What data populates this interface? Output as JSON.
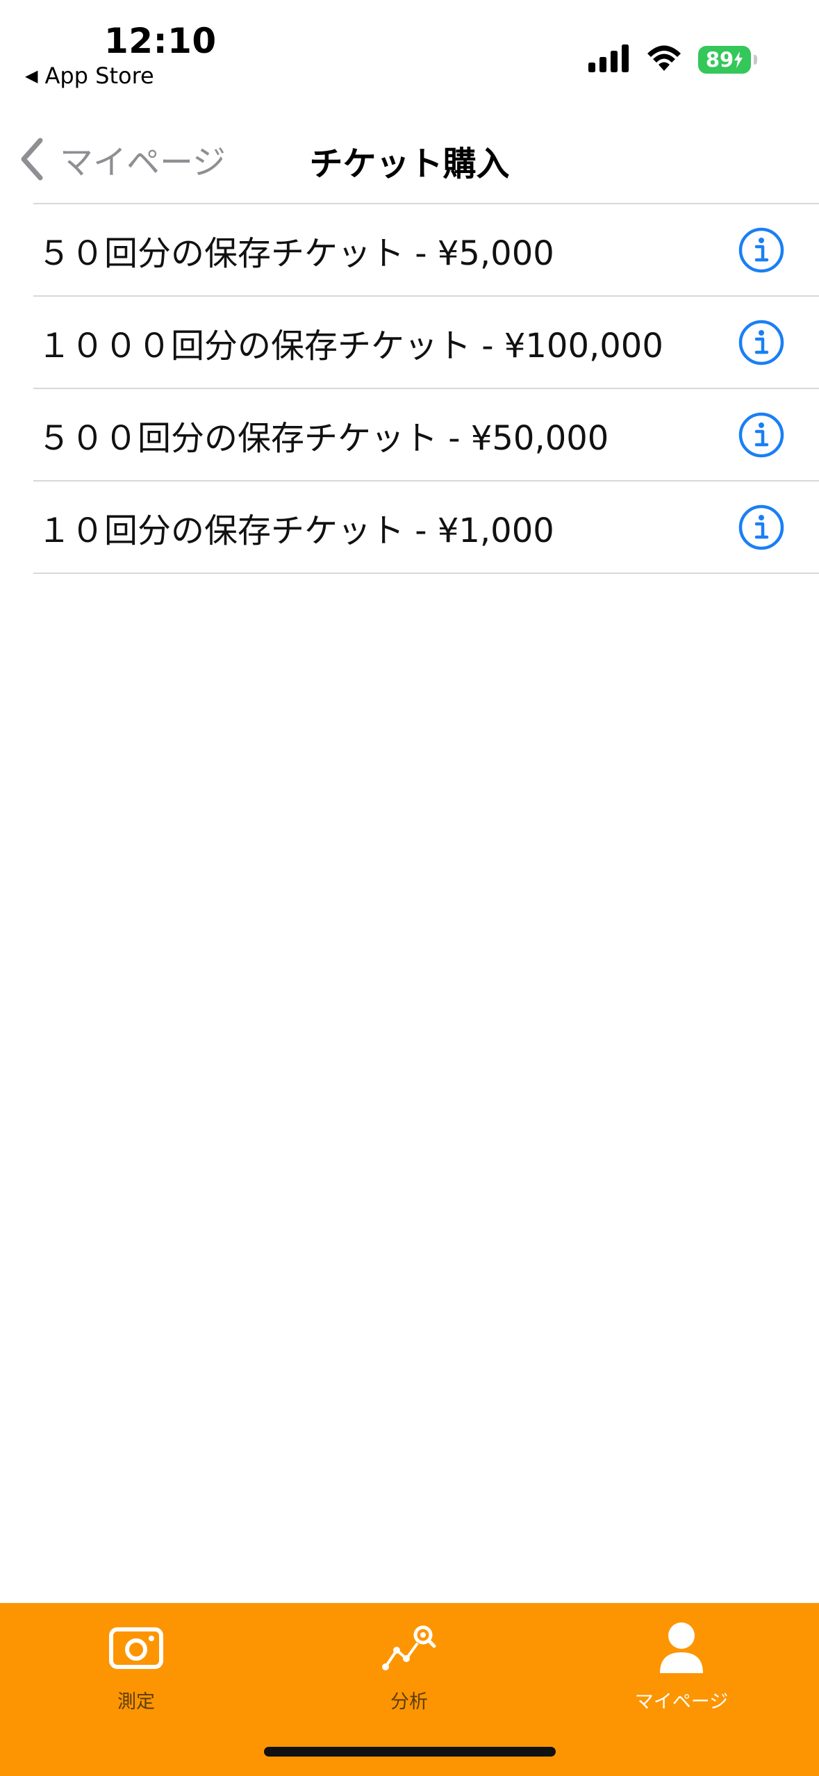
{
  "status_bar": {
    "time": "12:10",
    "back_app": "App Store",
    "battery": "89"
  },
  "nav": {
    "back_label": "マイページ",
    "title": "チケット購入"
  },
  "tickets": [
    {
      "label": "５０回分の保存チケット - ¥5,000"
    },
    {
      "label": "１０００回分の保存チケット - ¥100,000"
    },
    {
      "label": "５００回分の保存チケット - ¥50,000"
    },
    {
      "label": "１０回分の保存チケット - ¥1,000"
    }
  ],
  "tab_bar": {
    "items": [
      {
        "label": "測定",
        "icon": "camera-icon",
        "active": false
      },
      {
        "label": "分析",
        "icon": "analysis-icon",
        "active": false
      },
      {
        "label": "マイページ",
        "icon": "person-icon",
        "active": true
      }
    ]
  },
  "colors": {
    "accent": "#1a7ff5",
    "tab_bar_bg": "#fd9502",
    "battery": "#34c759",
    "separator": "#d8d8dc"
  }
}
